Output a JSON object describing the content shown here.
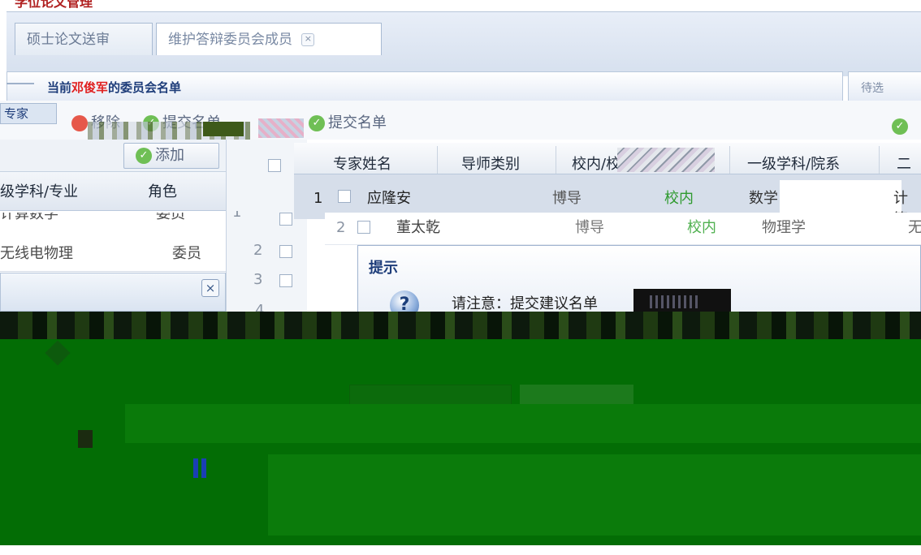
{
  "app": {
    "title": "学位论文管理"
  },
  "tabs": [
    {
      "label": "硕士论文送审"
    },
    {
      "label": "维护答辩委员会成员",
      "close": "×"
    }
  ],
  "panel": {
    "title_prefix": "当前",
    "person": "邓俊军",
    "title_suffix": "的委员会名单",
    "right_title": "待选"
  },
  "toolbar": {
    "expert": "专家",
    "remove": "移除",
    "submit": "提交名单",
    "add": "添加"
  },
  "left_grid": {
    "headers": {
      "subject": "级学科/专业",
      "role": "角色"
    },
    "rows": [
      {
        "subject": "计算数学",
        "role": "委员"
      },
      {
        "subject": "无线电物理",
        "role": "委员"
      }
    ],
    "dialog_close": "×"
  },
  "mid_rows": [
    "1",
    "2",
    "3",
    "4"
  ],
  "right_grid": {
    "headers": {
      "name": "专家姓名",
      "type": "导师类别",
      "in_out": "校内/校外",
      "dept": "一级学科/院系",
      "last": "二级"
    },
    "rows": [
      {
        "num": "1",
        "name": "应隆安",
        "type": "博导",
        "in_out": "校内",
        "dept": "数学",
        "last": "计算"
      },
      {
        "num": "2",
        "name": "董太乾",
        "type": "博导",
        "in_out": "校内",
        "dept": "物理学",
        "last": "无"
      }
    ]
  },
  "prompt": {
    "title": "提示",
    "icon": "?",
    "text": "请注意：提交建议名单"
  },
  "colors": {
    "accent": "#1e3d7a",
    "highlight_red": "#e02020",
    "status_green": "#2f9a2f",
    "corrupt_green": "#036d05"
  }
}
